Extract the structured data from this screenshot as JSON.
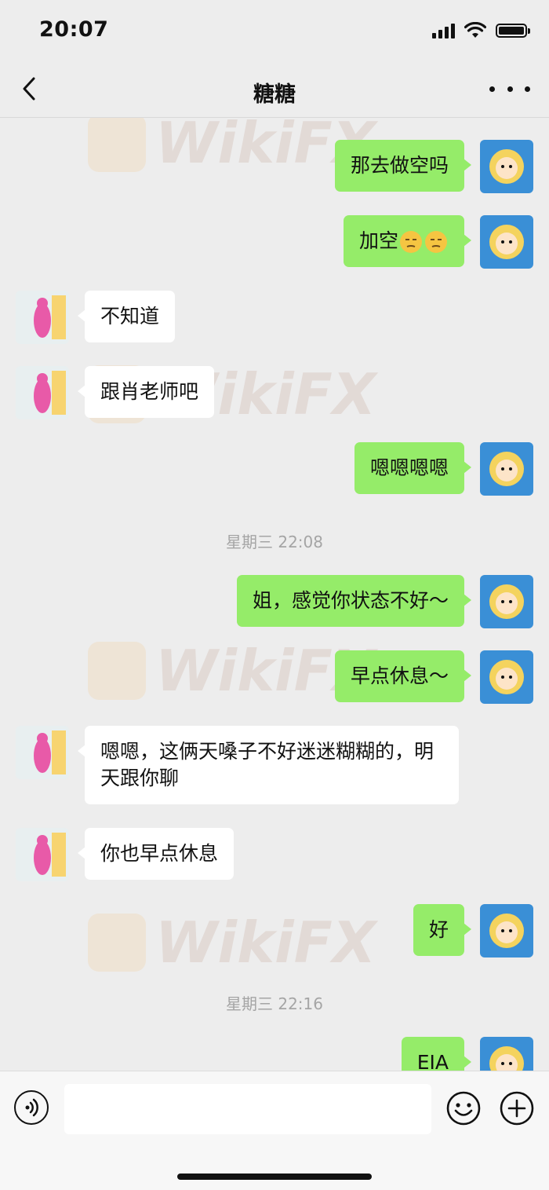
{
  "status_bar": {
    "time": "20:07"
  },
  "nav": {
    "title": "糖糖"
  },
  "messages": [
    {
      "side": "out",
      "text": "那去做空吗"
    },
    {
      "side": "out",
      "text": "加空",
      "emojis": [
        "smirk-face-icon",
        "smirk-face-icon"
      ]
    },
    {
      "side": "in",
      "text": "不知道"
    },
    {
      "side": "in",
      "text": "跟肖老师吧"
    },
    {
      "side": "out",
      "text": "嗯嗯嗯嗯"
    },
    {
      "side": "out",
      "text": "姐，感觉你状态不好～"
    },
    {
      "side": "out",
      "text": "早点休息～"
    },
    {
      "side": "in",
      "text": "嗯嗯，这俩天嗓子不好迷迷糊糊的，明天跟你聊"
    },
    {
      "side": "in",
      "text": "你也早点休息"
    },
    {
      "side": "out",
      "text": "好"
    },
    {
      "side": "out",
      "text": "EIA"
    }
  ],
  "timestamps": [
    "星期三 22:08",
    "星期三 22:16"
  ],
  "watermark": {
    "text": "WikiFX"
  },
  "input": {
    "value": "",
    "placeholder": ""
  },
  "colors": {
    "background": "#ededed",
    "outgoing_bubble": "#95ec69",
    "incoming_bubble": "#ffffff",
    "timestamp": "#a5a5a5"
  }
}
